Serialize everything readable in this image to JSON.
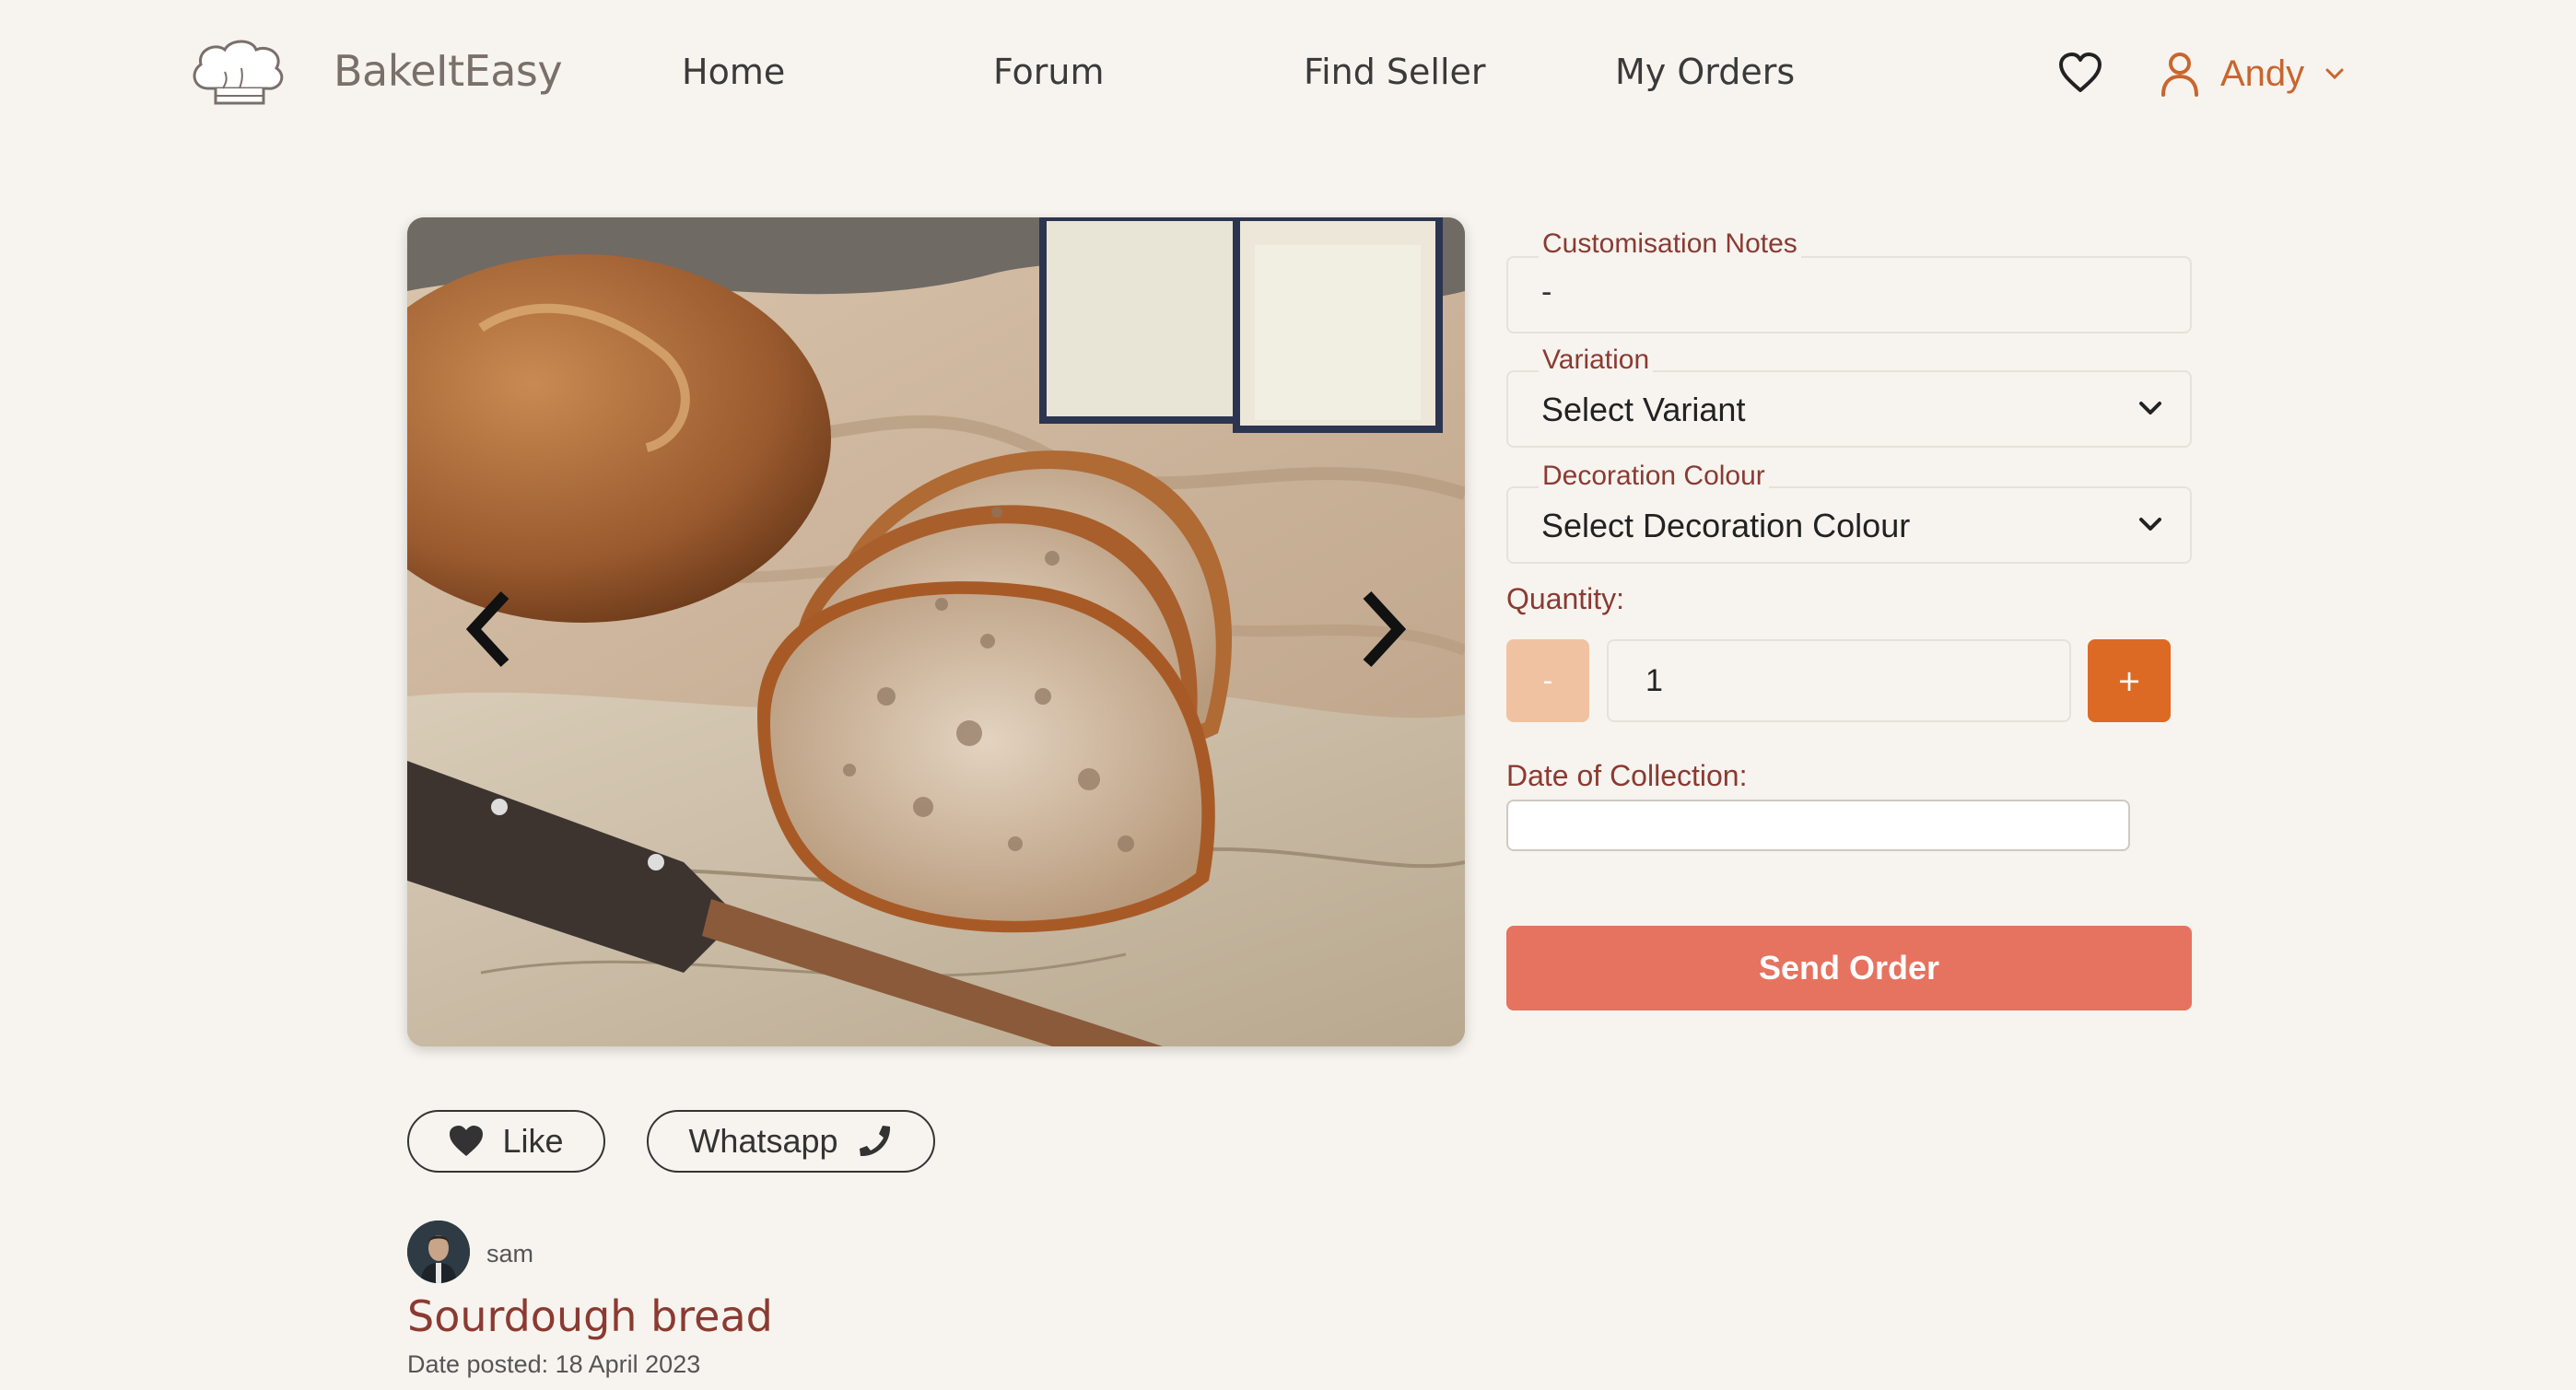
{
  "nav": {
    "brand": "BakeItEasy",
    "links": [
      "Home",
      "Forum",
      "Find Seller",
      "My Orders"
    ],
    "user_name": "Andy"
  },
  "actions": {
    "like_label": "Like",
    "whatsapp_label": "Whatsapp"
  },
  "post": {
    "poster_name": "sam",
    "title": "Sourdough bread",
    "date_text": "Date posted: 18 April 2023"
  },
  "form": {
    "notes_label": "Customisation Notes",
    "notes_value": "-",
    "variation_label": "Variation",
    "variation_value": "Select Variant",
    "decoration_label": "Decoration Colour",
    "decoration_value": "Select Decoration Colour",
    "quantity_label": "Quantity:",
    "quantity_minus": "-",
    "quantity_value": "1",
    "quantity_plus": "+",
    "date_label": "Date of Collection:",
    "date_value": "",
    "submit_label": "Send Order"
  },
  "colors": {
    "background": "#f7f4ef",
    "accent_orange": "#dd6a24",
    "label_maroon": "#8b3a32",
    "submit_button": "#e5735f",
    "minus_button": "#f0c2a2"
  }
}
